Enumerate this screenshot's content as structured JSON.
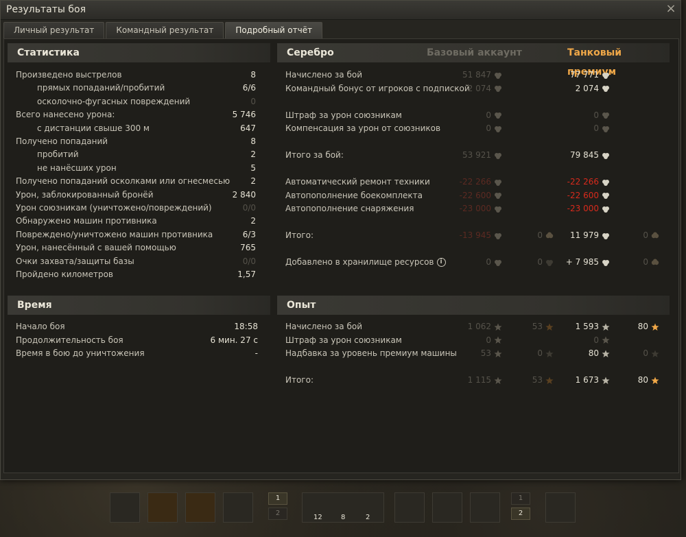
{
  "window": {
    "title": "Результаты боя",
    "close": "×"
  },
  "tabs": [
    {
      "label": "Личный результат",
      "active": false
    },
    {
      "label": "Командный результат",
      "active": false
    },
    {
      "label": "Подробный отчёт",
      "active": true
    }
  ],
  "stats": {
    "header": "Статистика",
    "rows": [
      {
        "label": "Произведено выстрелов",
        "value": "8",
        "indent": false,
        "dim": false
      },
      {
        "label": "прямых попаданий/пробитий",
        "value": "6/6",
        "indent": true,
        "dim": false
      },
      {
        "label": "осколочно-фугасных повреждений",
        "value": "0",
        "indent": true,
        "dim": true
      },
      {
        "label": "Всего нанесено урона:",
        "value": "5 746",
        "indent": false,
        "dim": false
      },
      {
        "label": "с дистанции свыше 300 м",
        "value": "647",
        "indent": true,
        "dim": false
      },
      {
        "label": "Получено попаданий",
        "value": "8",
        "indent": false,
        "dim": false
      },
      {
        "label": "пробитий",
        "value": "2",
        "indent": true,
        "dim": false
      },
      {
        "label": "не нанёсших урон",
        "value": "5",
        "indent": true,
        "dim": false
      },
      {
        "label": "Получено попаданий осколками или огнесмесью",
        "value": "2",
        "indent": false,
        "dim": false
      },
      {
        "label": "Урон, заблокированный бронёй",
        "value": "2 840",
        "indent": false,
        "dim": false
      },
      {
        "label": "Урон союзникам (уничтожено/повреждений)",
        "value": "0/0",
        "indent": false,
        "dim": true
      },
      {
        "label": "Обнаружено машин противника",
        "value": "2",
        "indent": false,
        "dim": false
      },
      {
        "label": "Повреждено/уничтожено машин противника",
        "value": "6/3",
        "indent": false,
        "dim": false
      },
      {
        "label": "Урон, нанесённый с вашей помощью",
        "value": "765",
        "indent": false,
        "dim": false
      },
      {
        "label": "Очки захвата/защиты базы",
        "value": "0/0",
        "indent": false,
        "dim": true
      },
      {
        "label": "Пройдено километров",
        "value": "1,57",
        "indent": false,
        "dim": false
      }
    ]
  },
  "time": {
    "header": "Время",
    "rows": [
      {
        "label": "Начало боя",
        "value": "18:58"
      },
      {
        "label": "Продолжительность боя",
        "value": "6 мин. 27 с"
      },
      {
        "label": "Время в бою до уничтожения",
        "value": "-"
      }
    ]
  },
  "silver": {
    "header": "Серебро",
    "col_basic": "Базовый аккаунт",
    "col_premium": "Танковый премиум",
    "rows": [
      {
        "label": "Начислено за бой",
        "basic": "51 847",
        "premium": "77 771",
        "gap": 0,
        "basic_class": "dim",
        "premium_class": ""
      },
      {
        "label": "Командный бонус от игроков с подпиской",
        "basic": "2 074",
        "premium": "2 074",
        "gap": 0,
        "basic_class": "dim",
        "premium_class": ""
      },
      {
        "label": "Штраф за урон союзникам",
        "basic": "0",
        "premium": "0",
        "gap": 1,
        "basic_class": "dim",
        "premium_class": "dim"
      },
      {
        "label": "Компенсация за урон от союзников",
        "basic": "0",
        "premium": "0",
        "gap": 0,
        "basic_class": "dim",
        "premium_class": "dim"
      },
      {
        "label": "Итого за бой:",
        "basic": "53 921",
        "premium": "79 845",
        "gap": 1,
        "basic_class": "dim",
        "premium_class": ""
      },
      {
        "label": "Автоматический ремонт техники",
        "basic": "-22 266",
        "premium": "-22 266",
        "gap": 1,
        "basic_class": "red-dim",
        "premium_class": "red"
      },
      {
        "label": "Автопополнение боекомплекта",
        "basic": "-22 600",
        "premium": "-22 600",
        "gap": 0,
        "basic_class": "red-dim",
        "premium_class": "red"
      },
      {
        "label": "Автопополнение снаряжения",
        "basic": "-23 000",
        "premium": "-23 000",
        "gap": 0,
        "basic_class": "red-dim",
        "premium_class": "red"
      }
    ],
    "total": {
      "label": "Итого:",
      "basic": "-13 945",
      "basic_gold": "0",
      "premium": "11 979",
      "premium_gold": "0"
    },
    "storage": {
      "label": "Добавлено в хранилище ресурсов",
      "basic": "0",
      "basic_gold": "0",
      "premium": "+ 7 985",
      "premium_gold": "0"
    }
  },
  "xp": {
    "header": "Опыт",
    "rows": [
      {
        "label": "Начислено за бой",
        "basic": "1 062",
        "basic_free": "53",
        "premium": "1 593",
        "premium_free": "80",
        "basic_class": "dim",
        "premium_class": "",
        "premium_free_class": ""
      },
      {
        "label": "Штраф за урон союзникам",
        "basic": "0",
        "basic_free": "",
        "premium": "0",
        "premium_free": "",
        "basic_class": "dim",
        "premium_class": "dim",
        "premium_free_class": "dim"
      },
      {
        "label": "Надбавка за уровень премиум машины",
        "basic": "53",
        "basic_free": "0",
        "premium": "80",
        "premium_free": "0",
        "basic_class": "dim",
        "premium_class": "",
        "premium_free_class": "dim"
      }
    ],
    "total": {
      "label": "Итого:",
      "basic": "1 115",
      "basic_free": "53",
      "premium": "1 673",
      "premium_free": "80"
    }
  },
  "hotbar": {
    "slot_numbers": [
      "1",
      "2",
      "1",
      "2"
    ],
    "ammo": [
      "12",
      "8",
      "2"
    ]
  },
  "colors": {
    "accent": "#f0a848",
    "negative": "#d82a1c"
  }
}
